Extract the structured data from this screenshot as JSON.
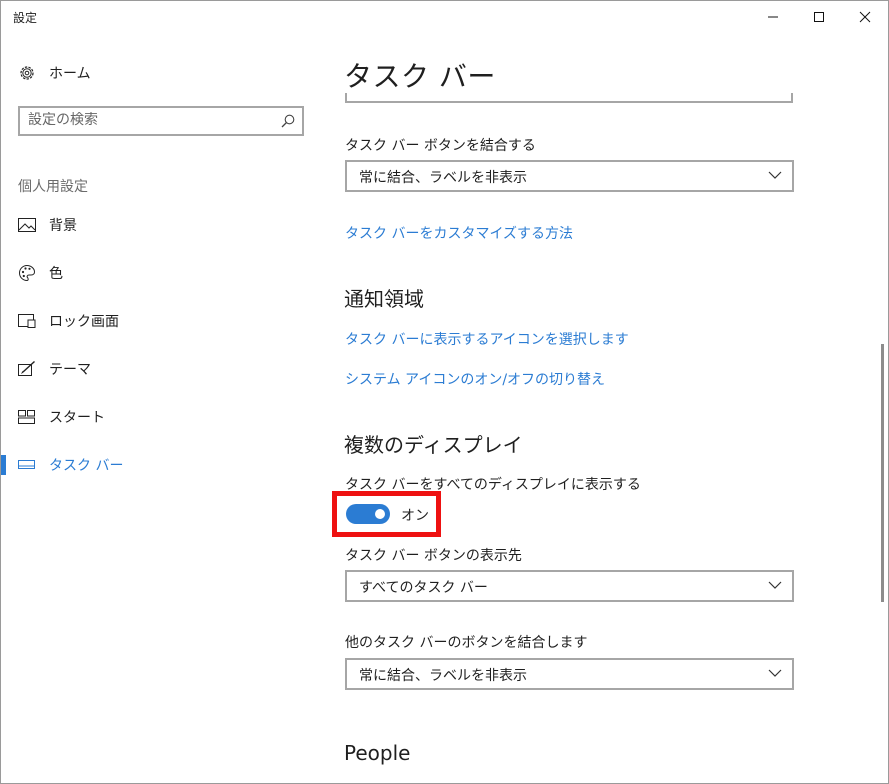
{
  "window": {
    "title": "設定",
    "controls": [
      "minimize-icon",
      "maximize-icon",
      "close-icon"
    ]
  },
  "sidebar": {
    "home": {
      "label": "ホーム",
      "icon": "gear-icon"
    },
    "search": {
      "placeholder": "設定の検索",
      "icon": "search-icon"
    },
    "section": "個人用設定",
    "items": [
      {
        "label": "背景",
        "icon": "picture-icon"
      },
      {
        "label": "色",
        "icon": "palette-icon"
      },
      {
        "label": "ロック画面",
        "icon": "lock-screen-icon"
      },
      {
        "label": "テーマ",
        "icon": "theme-brush-icon"
      },
      {
        "label": "スタート",
        "icon": "start-tiles-icon"
      },
      {
        "label": "タスク バー",
        "icon": "taskbar-icon",
        "active": true
      }
    ]
  },
  "main": {
    "title": "タスク バー",
    "combine": {
      "label": "タスク バー ボタンを結合する",
      "value": "常に結合、ラベルを非表示"
    },
    "customize_link": "タスク バーをカスタマイズする方法",
    "notification": {
      "heading": "通知領域",
      "link1": "タスク バーに表示するアイコンを選択します",
      "link2": "システム アイコンのオン/オフの切り替え"
    },
    "multi_display": {
      "heading": "複数のディスプレイ",
      "show_label": "タスク バーをすべてのディスプレイに表示する",
      "toggle_state": "オン",
      "toggle_on": true,
      "buttons_on_label": "タスク バー ボタンの表示先",
      "buttons_on_value": "すべてのタスク バー",
      "combine_other_label": "他のタスク バーのボタンを結合します",
      "combine_other_value": "常に結合、ラベルを非表示"
    },
    "people_heading": "People"
  },
  "colors": {
    "accent": "#2b7cd3",
    "highlight": "#ee1111",
    "border": "#a6a6a6"
  }
}
